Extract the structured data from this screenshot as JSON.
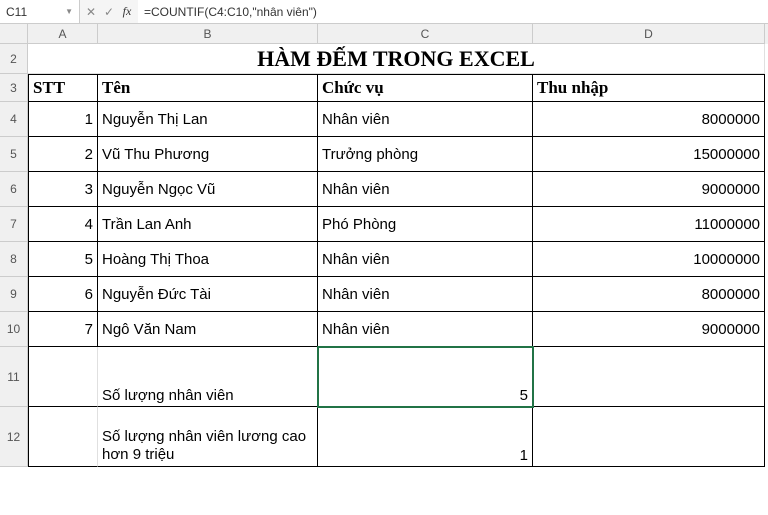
{
  "formula_bar": {
    "name_box": "C11",
    "formula": "=COUNTIF(C4:C10,\"nhân viên\")"
  },
  "columns": [
    "A",
    "B",
    "C",
    "D"
  ],
  "row_nums": [
    "2",
    "3",
    "4",
    "5",
    "6",
    "7",
    "8",
    "9",
    "10",
    "11",
    "12"
  ],
  "title": "HÀM ĐẾM TRONG EXCEL",
  "headers": {
    "a": "STT",
    "b": "Tên",
    "c": "Chức vụ",
    "d": "Thu nhập"
  },
  "rows": [
    {
      "stt": "1",
      "ten": "Nguyễn Thị Lan",
      "cv": "Nhân viên",
      "tn": "8000000"
    },
    {
      "stt": "2",
      "ten": "Vũ Thu Phương",
      "cv": "Trưởng phòng",
      "tn": "15000000"
    },
    {
      "stt": "3",
      "ten": "Nguyễn Ngọc Vũ",
      "cv": "Nhân viên",
      "tn": "9000000"
    },
    {
      "stt": "4",
      "ten": "Trần Lan Anh",
      "cv": "Phó Phòng",
      "tn": "11000000"
    },
    {
      "stt": "5",
      "ten": "Hoàng Thị Thoa",
      "cv": "Nhân viên",
      "tn": "10000000"
    },
    {
      "stt": "6",
      "ten": "Nguyễn Đức Tài",
      "cv": "Nhân viên",
      "tn": "8000000"
    },
    {
      "stt": "7",
      "ten": "Ngô Văn Nam",
      "cv": "Nhân viên",
      "tn": "9000000"
    }
  ],
  "summary": {
    "label1": "Số lượng nhân viên",
    "val1": "5",
    "label2": "Số lượng nhân viên lương cao hơn 9 triệu",
    "val2": "1"
  },
  "chart_data": {
    "type": "table",
    "title": "HÀM ĐẾM TRONG EXCEL",
    "columns": [
      "STT",
      "Tên",
      "Chức vụ",
      "Thu nhập"
    ],
    "rows": [
      [
        1,
        "Nguyễn Thị Lan",
        "Nhân viên",
        8000000
      ],
      [
        2,
        "Vũ Thu Phương",
        "Trưởng phòng",
        15000000
      ],
      [
        3,
        "Nguyễn Ngọc Vũ",
        "Nhân viên",
        9000000
      ],
      [
        4,
        "Trần Lan Anh",
        "Phó Phòng",
        11000000
      ],
      [
        5,
        "Hoàng Thị Thoa",
        "Nhân viên",
        10000000
      ],
      [
        6,
        "Nguyễn Đức Tài",
        "Nhân viên",
        8000000
      ],
      [
        7,
        "Ngô Văn Nam",
        "Nhân viên",
        9000000
      ]
    ],
    "summaries": [
      {
        "label": "Số lượng nhân viên",
        "value": 5,
        "formula": "=COUNTIF(C4:C10,\"nhân viên\")"
      },
      {
        "label": "Số lượng nhân viên lương cao hơn 9 triệu",
        "value": 1
      }
    ]
  }
}
